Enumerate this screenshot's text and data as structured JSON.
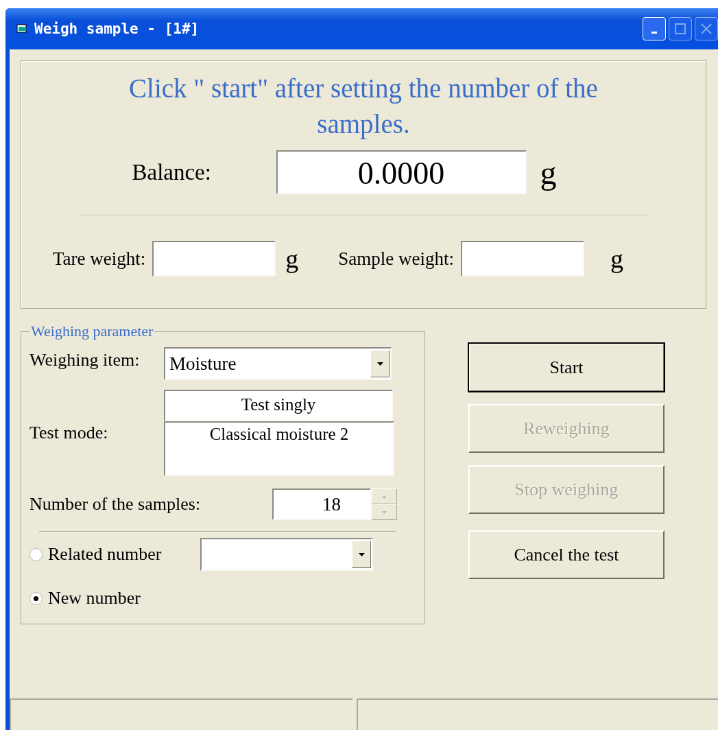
{
  "window": {
    "title": "Weigh sample - [1#]",
    "controls": [
      {
        "kind": "minimize",
        "disabled": false
      },
      {
        "kind": "maximize",
        "disabled": true
      },
      {
        "kind": "close",
        "disabled": true
      }
    ]
  },
  "message": "Click \" start\" after setting the number of the samples.",
  "balance": {
    "label": "Balance:",
    "value": "0.0000",
    "unit": "g"
  },
  "tare": {
    "label": "Tare weight:",
    "unit": "g"
  },
  "sample": {
    "label": "Sample weight:",
    "unit": "g"
  },
  "parameters": {
    "title": "Weighing parameter",
    "item": {
      "label": "Weighing item:",
      "value": "Moisture"
    },
    "test_mode": {
      "label": "Test mode:",
      "value": "Test singly",
      "detail": "Classical moisture 2"
    },
    "samples": {
      "label": "Number of the samples:",
      "value": "18"
    },
    "options": [
      {
        "label": "Related number",
        "selected": false,
        "kind": "dropdown"
      },
      {
        "label": "New number",
        "selected": true,
        "kind": "plain"
      }
    ]
  },
  "buttons": [
    {
      "label": "Start",
      "disabled": false,
      "default": true
    },
    {
      "label": "Reweighing",
      "disabled": true,
      "default": false
    },
    {
      "label": "Stop weighing",
      "disabled": true,
      "default": false
    },
    {
      "label": "Cancel the test",
      "disabled": false,
      "default": false
    }
  ]
}
